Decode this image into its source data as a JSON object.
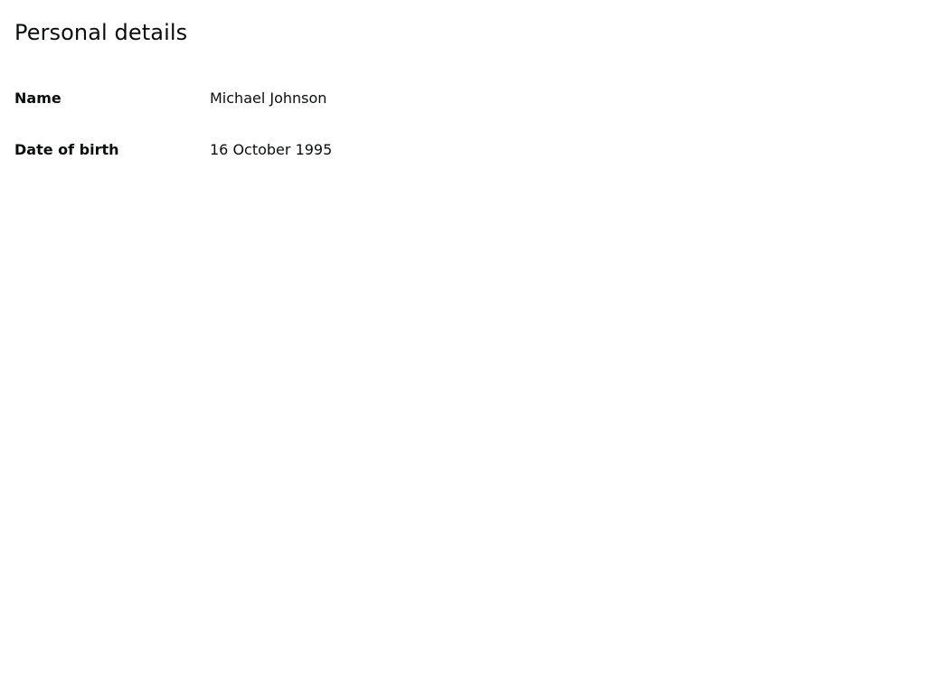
{
  "page": {
    "title": "Personal details"
  },
  "summary": {
    "rows": [
      {
        "key": "Name",
        "value": "Michael Johnson"
      },
      {
        "key": "Date of birth",
        "value": "16 October 1995"
      }
    ]
  }
}
